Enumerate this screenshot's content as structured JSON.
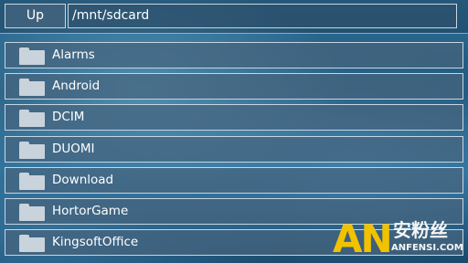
{
  "toolbar": {
    "up_label": "Up",
    "path": "/mnt/sdcard"
  },
  "folders": [
    {
      "label": "Alarms",
      "icon": "folder-icon"
    },
    {
      "label": "Android",
      "icon": "folder-icon"
    },
    {
      "label": "DCIM",
      "icon": "folder-icon"
    },
    {
      "label": "DUOMI",
      "icon": "folder-icon"
    },
    {
      "label": "Download",
      "icon": "folder-icon"
    },
    {
      "label": "HortorGame",
      "icon": "folder-icon"
    },
    {
      "label": "KingsoftOffice",
      "icon": "folder-icon"
    }
  ],
  "watermark": {
    "mark": "AN",
    "name": "安粉丝",
    "url": "ANFENSI.COM"
  },
  "colors": {
    "row_fill": "#46647d",
    "row_border": "#c8d6e0",
    "folder_icon": "#c9d3dc",
    "watermark_gold": "#f2c200",
    "background": "#1f5478"
  }
}
